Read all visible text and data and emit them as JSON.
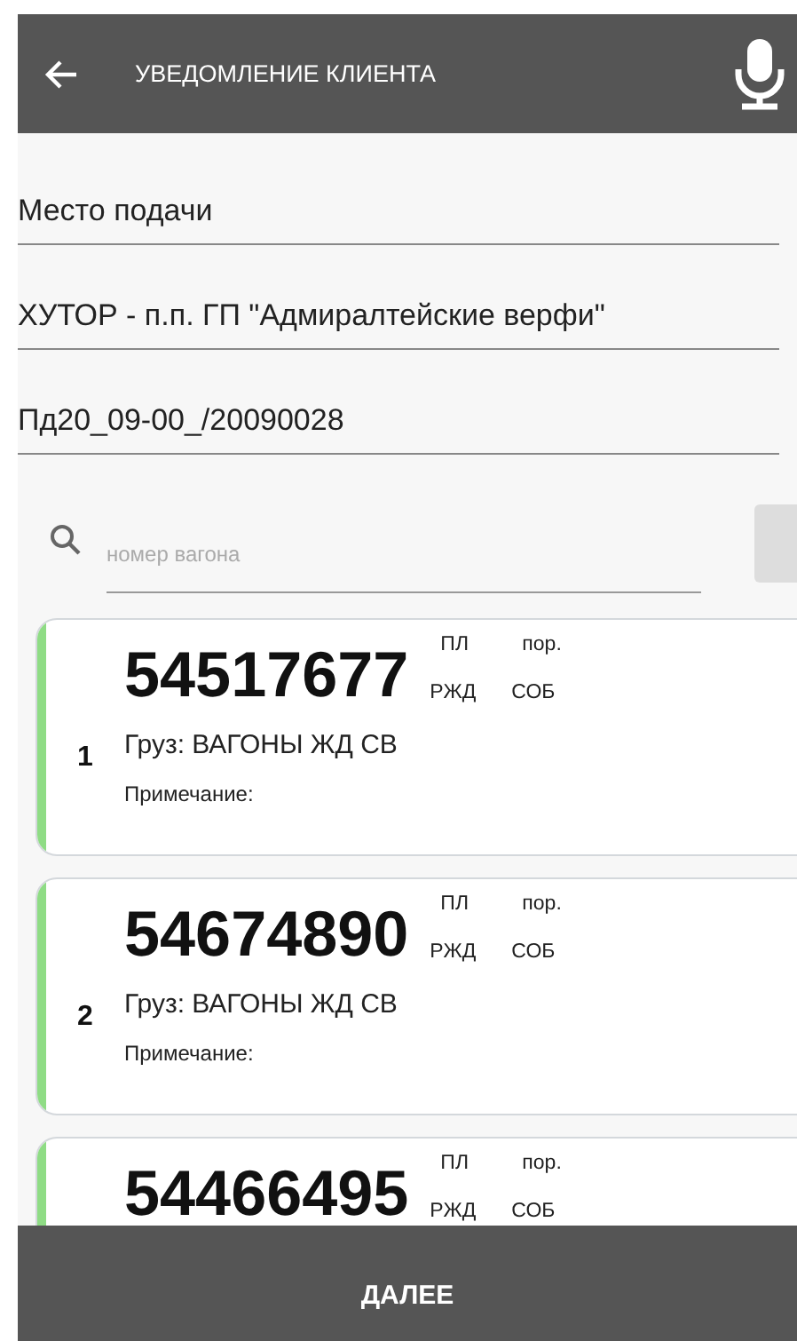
{
  "header": {
    "title": "УВЕДОМЛЕНИЕ КЛИЕНТА"
  },
  "fields": [
    {
      "value": "Место подачи"
    },
    {
      "value": "ХУТОР - п.п. ГП \"Адмиралтейские верфи\""
    },
    {
      "value": "Пд20_09-00_/20090028"
    }
  ],
  "search": {
    "placeholder": "номер вагона"
  },
  "wagons": [
    {
      "index": "1",
      "number": "54517677",
      "tag_1": "ПЛ",
      "tag_2": "пор.",
      "tag_3": "РЖД",
      "tag_4": "СОБ",
      "cargo": "Груз: ВАГОНЫ ЖД СВ",
      "note": "Примечание:",
      "color": "#8fdc85"
    },
    {
      "index": "2",
      "number": "54674890",
      "tag_1": "ПЛ",
      "tag_2": "пор.",
      "tag_3": "РЖД",
      "tag_4": "СОБ",
      "cargo": "Груз: ВАГОНЫ ЖД СВ",
      "note": "Примечание:",
      "color": "#8fdc85"
    },
    {
      "number": "54466495",
      "tag_1": "ПЛ",
      "tag_2": "пор.",
      "tag_3": "РЖД",
      "tag_4": "СОБ",
      "color": "#8fdc85"
    }
  ],
  "footer": {
    "button": "ДАЛЕЕ"
  }
}
